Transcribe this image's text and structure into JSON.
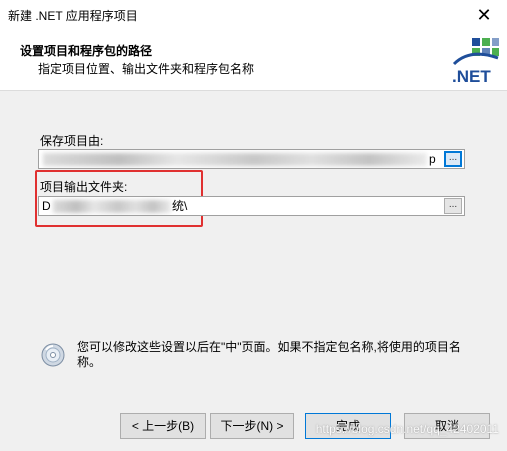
{
  "window": {
    "title": "新建 .NET 应用程序项目",
    "close_glyph": "✕"
  },
  "header": {
    "title": "设置项目和程序包的路径",
    "subtitle": "指定项目位置、输出文件夹和程序包名称",
    "logo_text": ".NET"
  },
  "form": {
    "project_location_label": "保存项目由:",
    "project_location_value_tail": "p",
    "output_folder_label": "项目输出文件夹:",
    "output_folder_value_head": "D",
    "output_folder_value_tail": "统\\",
    "browse_label": "..."
  },
  "info": {
    "text": "您可以修改这些设置以后在\"中\"页面。如果不指定包名称,将使用的项目名称。",
    "icon": "disc-icon"
  },
  "buttons": {
    "back": "< 上一步(B)",
    "next": "下一步(N) >",
    "finish": "完成",
    "cancel": "取消"
  },
  "watermark": "https://blog.csdn.net/qq_42402011",
  "colors": {
    "highlight": "#e03030",
    "accent": "#0078d7",
    "logo_blue": "#1f4e9a",
    "logo_green": "#4caf50"
  }
}
